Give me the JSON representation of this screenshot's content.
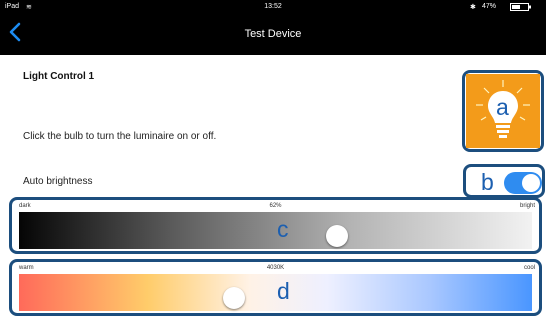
{
  "status": {
    "device": "iPad",
    "wifi_icon": "wifi-icon",
    "time": "13:52",
    "battery": "47%",
    "bluetooth_icon": "bluetooth-icon"
  },
  "nav": {
    "title": "Test Device",
    "back_icon": "chevron-left-icon"
  },
  "light": {
    "heading": "Light Control 1",
    "instruction": "Click the bulb to turn the luminaire on or off.",
    "bulb_icon": "lightbulb-icon"
  },
  "auto": {
    "label": "Auto brightness",
    "enabled": true
  },
  "brightness": {
    "min_label": "dark",
    "max_label": "bright",
    "value_label": "62%",
    "value": 0.62
  },
  "color_temp": {
    "min_label": "warm",
    "max_label": "cool",
    "value_label": "4030K",
    "value": 0.42
  },
  "annotations": {
    "a": "a",
    "b": "b",
    "c": "c",
    "d": "d"
  },
  "colors": {
    "accent": "#2f8cf0",
    "callout": "#1c4e7e",
    "bulb_bg": "#f39b1a"
  }
}
